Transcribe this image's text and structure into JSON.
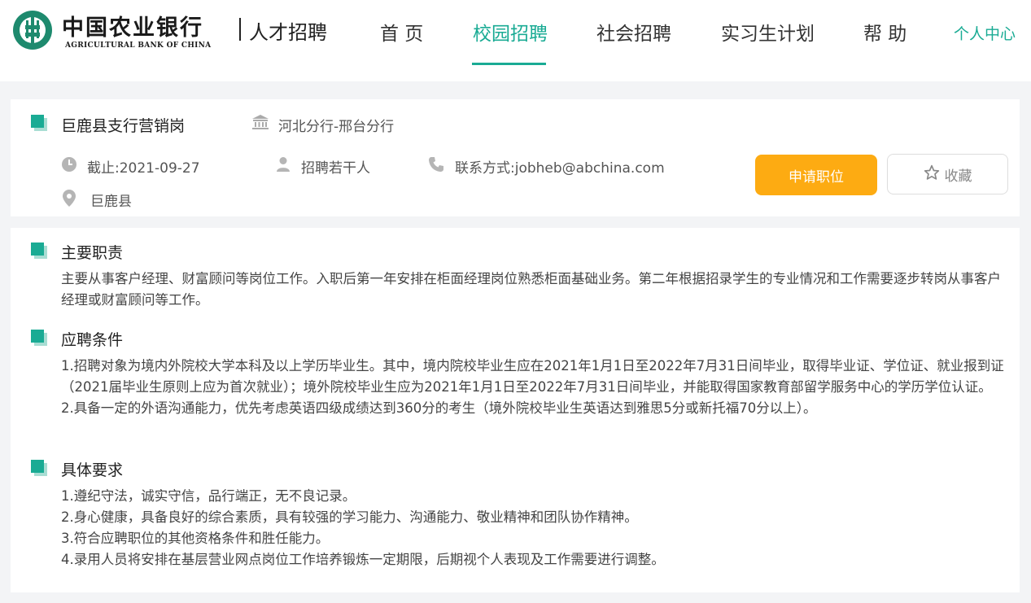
{
  "header": {
    "logo_cn": "中国农业银行",
    "logo_en": "AGRICULTURAL BANK OF CHINA",
    "subtitle": "人才招聘",
    "nav": [
      "首 页",
      "校园招聘",
      "社会招聘",
      "实习生计划",
      "帮 助"
    ],
    "active_nav": "校园招聘",
    "user_center": "个人中心"
  },
  "job": {
    "title": "巨鹿县支行营销岗",
    "branch": "河北分行-邢台分行",
    "deadline": "截止:2021-09-27",
    "headcount": "招聘若干人",
    "contact": "联系方式:jobheb@abchina.com",
    "location": "巨鹿县",
    "apply_label": "申请职位",
    "favorite_label": "收藏"
  },
  "sections": [
    {
      "title": "主要职责",
      "lines": [
        "主要从事客户经理、财富顾问等岗位工作。入职后第一年安排在柜面经理岗位熟悉柜面基础业务。第二年根据招录学生的专业情况和工作需要逐步转岗从事客户经理或财富顾问等工作。"
      ]
    },
    {
      "title": "应聘条件",
      "lines": [
        "1.招聘对象为境内外院校大学本科及以上学历毕业生。其中，境内院校毕业生应在2021年1月1日至2022年7月31日间毕业，取得毕业证、学位证、就业报到证（2021届毕业生原则上应为首次就业）；境外院校毕业生应为2021年1月1日至2022年7月31日间毕业，并能取得国家教育部留学服务中心的学历学位认证。",
        "2.具备一定的外语沟通能力，优先考虑英语四级成绩达到360分的考生（境外院校毕业生英语达到雅思5分或新托福70分以上）。"
      ]
    },
    {
      "title": "具体要求",
      "lines": [
        "1.遵纪守法，诚实守信，品行端正，无不良记录。",
        "2.身心健康，具备良好的综合素质，具有较强的学习能力、沟通能力、敬业精神和团队协作精神。",
        "3.符合应聘职位的其他资格条件和胜任能力。",
        "4.录用人员将安排在基层营业网点岗位工作培养锻炼一定期限，后期视个人表现及工作需要进行调整。"
      ]
    }
  ],
  "colors": {
    "accent": "#1aab94",
    "apply_button": "#fdab12",
    "logo_green": "#1e8a6e"
  },
  "icons": [
    "bank-building-icon",
    "clock-icon",
    "person-icon",
    "phone-icon",
    "location-pin-icon",
    "star-icon"
  ]
}
